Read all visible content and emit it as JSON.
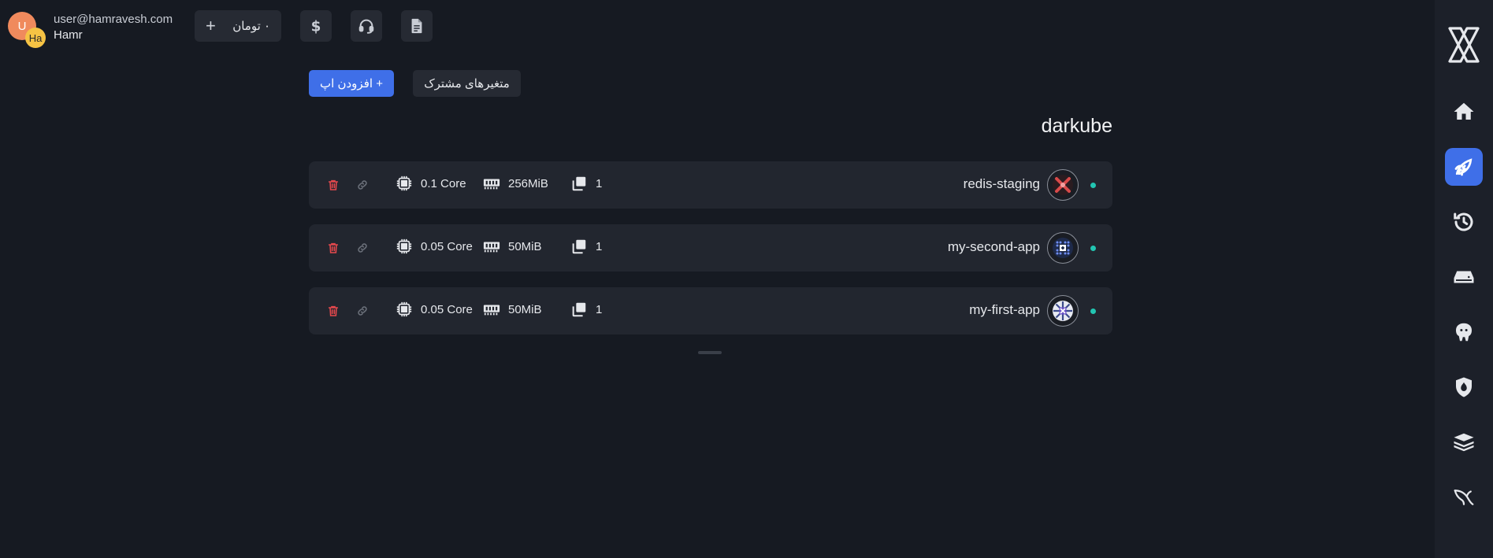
{
  "user": {
    "email": "user@hamravesh.com",
    "name": "Hamr",
    "avatar_primary": "U",
    "avatar_secondary": "Ha"
  },
  "wallet": {
    "amount": "۰ تومان",
    "add_label": "+"
  },
  "header_icons": [
    "dollar-icon",
    "headset-icon",
    "document-icon"
  ],
  "actions": {
    "add_app_label": "+ افزودن اپ",
    "shared_vars_label": "متغیرهای مشترک"
  },
  "project": {
    "title": "darkube"
  },
  "apps": [
    {
      "name": "redis-staging",
      "cpu": "0.1 Core",
      "ram": "256MiB",
      "replicas": "1",
      "logo": "redis-logo-icon"
    },
    {
      "name": "my-second-app",
      "cpu": "0.05 Core",
      "ram": "50MiB",
      "replicas": "1",
      "logo": "docker-logo-icon"
    },
    {
      "name": "my-first-app",
      "cpu": "0.05 Core",
      "ram": "50MiB",
      "replicas": "1",
      "logo": "kube-logo-icon"
    }
  ],
  "sidebar": {
    "items": [
      "home-icon",
      "rocket-icon",
      "history-icon",
      "storage-icon",
      "postgres-icon",
      "shield-icon",
      "layers-icon",
      "mysql-icon"
    ],
    "active_index": 1
  },
  "colors": {
    "accent": "#3f6fe8",
    "status_ok": "#22c5b2",
    "delete": "#e5484d",
    "background": "#161a22",
    "card": "#22262f"
  }
}
